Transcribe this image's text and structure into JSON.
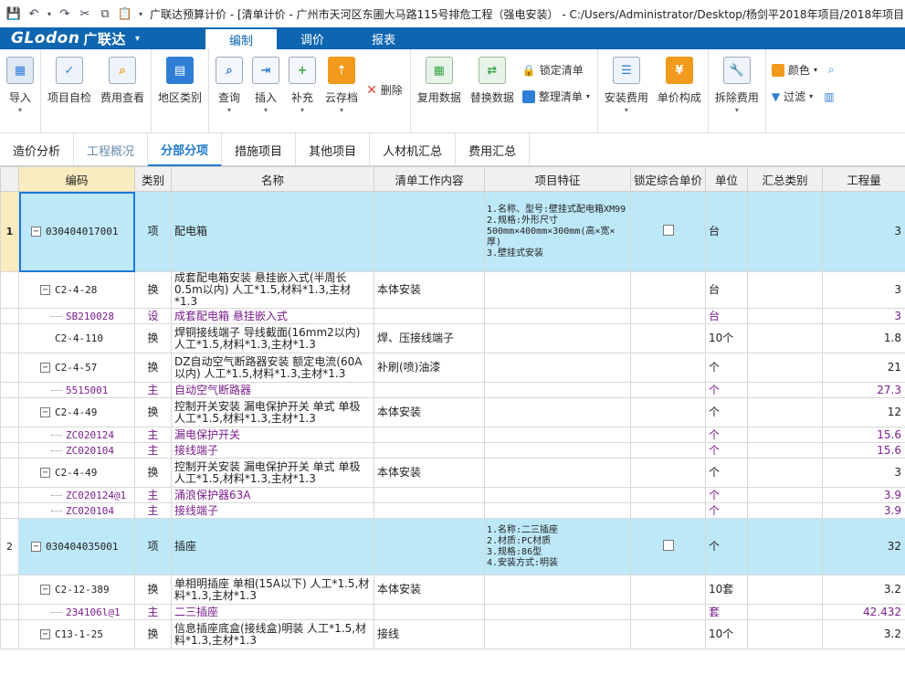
{
  "window": {
    "title": "广联达预算计价 - [清单计价 - 广州市天河区东圃大马路115号排危工程（强电安装） - C:/Users/Administrator/Desktop/杨剑平2018年项目/2018年项目"
  },
  "logo": {
    "brand": "GLodon",
    "cn": "广联达",
    "dropdown": "▾"
  },
  "ribbon_tabs": [
    {
      "label": "编制",
      "active": true
    },
    {
      "label": "调价",
      "active": false
    },
    {
      "label": "报表",
      "active": false
    }
  ],
  "toolbar": {
    "import": "导入",
    "project_check": "项目自检",
    "fee_view": "费用查看",
    "region": "地区类别",
    "query": "查询",
    "insert": "插入",
    "supplement": "补充",
    "cloud_save": "云存档",
    "delete": "删除",
    "reuse_data": "复用数据",
    "replace_data": "替换数据",
    "lock_list": "锁定清单",
    "organize_list": "整理清单",
    "install_fee": "安装费用",
    "unit_price": "单价构成",
    "dismantle_fee": "拆除费用",
    "color": "颜色",
    "filter": "过滤",
    "colors": {
      "blue": "#2f7fd6",
      "orange": "#f29a1d",
      "green": "#3ea84d",
      "red": "#e0443a"
    }
  },
  "sub_tabs": [
    {
      "label": "造价分析",
      "state": "normal"
    },
    {
      "label": "工程概况",
      "state": "dim"
    },
    {
      "label": "分部分项",
      "state": "active"
    },
    {
      "label": "措施项目",
      "state": "normal"
    },
    {
      "label": "其他项目",
      "state": "normal"
    },
    {
      "label": "人材机汇总",
      "state": "normal"
    },
    {
      "label": "费用汇总",
      "state": "normal"
    }
  ],
  "grid": {
    "headers": [
      "",
      "编码",
      "类别",
      "名称",
      "清单工作内容",
      "项目特征",
      "锁定综合单价",
      "单位",
      "汇总类别",
      "工程量"
    ],
    "rows": [
      {
        "rn": "1",
        "kind": "qd",
        "code": "030404017001",
        "cat": "项",
        "name": "配电箱",
        "work": "",
        "feat": "1.名称、型号:壁挂式配电箱XM99\n2.规格:外形尺寸500mm×400mm×300mm(高×宽×厚)\n3.壁挂式安装",
        "lock": true,
        "unit": "台",
        "sum": "",
        "qty": "3"
      },
      {
        "rn": "",
        "kind": "de",
        "code": "C2-4-28",
        "cat": "换",
        "name": "成套配电箱安装 悬挂嵌入式(半周长0.5m以内) 人工*1.5,材料*1.3,主材*1.3",
        "work": "本体安装",
        "feat": "",
        "lock": false,
        "unit": "台",
        "sum": "",
        "qty": "3"
      },
      {
        "rn": "",
        "kind": "mat",
        "code": "SB210028",
        "cat": "设",
        "name": "成套配电箱 悬挂嵌入式",
        "work": "",
        "feat": "",
        "lock": false,
        "unit": "台",
        "sum": "",
        "qty": "3"
      },
      {
        "rn": "",
        "kind": "de",
        "code": "C2-4-110",
        "cat": "换",
        "name": "焊铜接线端子 导线截面(16mm2以内) 人工*1.5,材料*1.3,主材*1.3",
        "work": "焊、压接线端子",
        "feat": "",
        "lock": false,
        "unit": "10个",
        "sum": "",
        "qty": "1.8"
      },
      {
        "rn": "",
        "kind": "de",
        "code": "C2-4-57",
        "cat": "换",
        "name": "DZ自动空气断路器安装 额定电流(60A以内) 人工*1.5,材料*1.3,主材*1.3",
        "work": "补刷(喷)油漆",
        "feat": "",
        "lock": false,
        "unit": "个",
        "sum": "",
        "qty": "21"
      },
      {
        "rn": "",
        "kind": "mat",
        "code": "5515001",
        "cat": "主",
        "name": "自动空气断路器",
        "work": "",
        "feat": "",
        "lock": false,
        "unit": "个",
        "sum": "",
        "qty": "27.3"
      },
      {
        "rn": "",
        "kind": "de",
        "code": "C2-4-49",
        "cat": "换",
        "name": "控制开关安装 漏电保护开关 单式 单极 人工*1.5,材料*1.3,主材*1.3",
        "work": "本体安装",
        "feat": "",
        "lock": false,
        "unit": "个",
        "sum": "",
        "qty": "12"
      },
      {
        "rn": "",
        "kind": "mat",
        "code": "ZC020124",
        "cat": "主",
        "name": "漏电保护开关",
        "work": "",
        "feat": "",
        "lock": false,
        "unit": "个",
        "sum": "",
        "qty": "15.6"
      },
      {
        "rn": "",
        "kind": "mat",
        "code": "ZC020104",
        "cat": "主",
        "name": "接线端子",
        "work": "",
        "feat": "",
        "lock": false,
        "unit": "个",
        "sum": "",
        "qty": "15.6"
      },
      {
        "rn": "",
        "kind": "de",
        "code": "C2-4-49",
        "cat": "换",
        "name": "控制开关安装 漏电保护开关 单式 单极 人工*1.5,材料*1.3,主材*1.3",
        "work": "本体安装",
        "feat": "",
        "lock": false,
        "unit": "个",
        "sum": "",
        "qty": "3"
      },
      {
        "rn": "",
        "kind": "mat",
        "code": "ZC020124@1",
        "cat": "主",
        "name": "涌浪保护器63A",
        "work": "",
        "feat": "",
        "lock": false,
        "unit": "个",
        "sum": "",
        "qty": "3.9"
      },
      {
        "rn": "",
        "kind": "mat",
        "code": "ZC020104",
        "cat": "主",
        "name": "接线端子",
        "work": "",
        "feat": "",
        "lock": false,
        "unit": "个",
        "sum": "",
        "qty": "3.9"
      },
      {
        "rn": "2",
        "kind": "qd",
        "code": "030404035001",
        "cat": "项",
        "name": "插座",
        "work": "",
        "feat": "1.名称:二三插座\n2.材质:PC材质\n3.规格:86型\n4.安装方式:明装",
        "lock": true,
        "unit": "个",
        "sum": "",
        "qty": "32"
      },
      {
        "rn": "",
        "kind": "de",
        "code": "C2-12-389",
        "cat": "换",
        "name": "单相明插座 单相(15A以下) 人工*1.5,材料*1.3,主材*1.3",
        "work": "本体安装",
        "feat": "",
        "lock": false,
        "unit": "10套",
        "sum": "",
        "qty": "3.2"
      },
      {
        "rn": "",
        "kind": "mat",
        "code": "234106l@1",
        "cat": "主",
        "name": "二三插座",
        "work": "",
        "feat": "",
        "lock": false,
        "unit": "套",
        "sum": "",
        "qty": "42.432"
      },
      {
        "rn": "",
        "kind": "de",
        "code": "C13-1-25",
        "cat": "换",
        "name": "信息插座底盒(接线盒)明装 人工*1.5,材料*1.3,主材*1.3",
        "work": "接线",
        "feat": "",
        "lock": false,
        "unit": "10个",
        "sum": "",
        "qty": "3.2"
      }
    ]
  }
}
